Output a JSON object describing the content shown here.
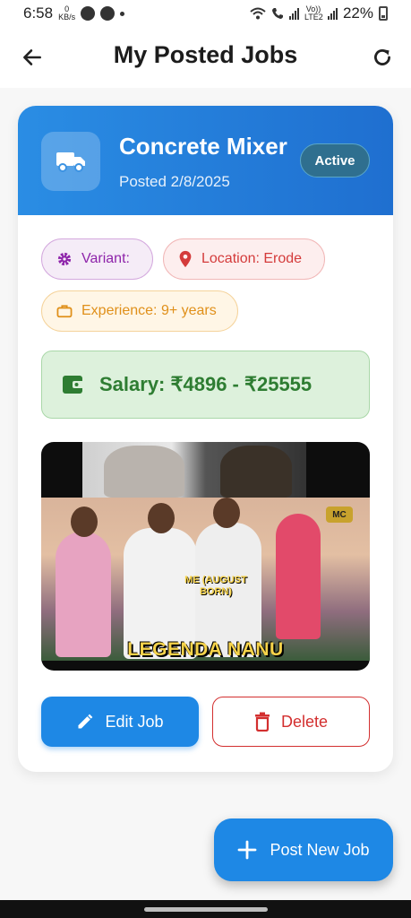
{
  "status_bar": {
    "time": "6:58",
    "net_speed_value": "0",
    "net_speed_unit": "KB/s",
    "battery": "22%",
    "volte_label": "Vo)) LTE2"
  },
  "app_bar": {
    "title": "My Posted Jobs",
    "back_icon": "arrow-back-icon",
    "refresh_icon": "refresh-icon"
  },
  "job": {
    "title": "Concrete Mixer",
    "posted": "Posted 2/8/2025",
    "status": "Active",
    "icon": "truck-icon",
    "chips": {
      "variant": "Variant:",
      "location": "Location: Erode",
      "experience": "Experience: 9+ years"
    },
    "salary": "Salary: ₹4896 - ₹25555",
    "image": {
      "caption_top": "ME (AUGUST BORN)",
      "caption_bottom": "LEGENDA NANU",
      "logo_text": "MC"
    },
    "actions": {
      "edit_label": "Edit Job",
      "delete_label": "Delete"
    }
  },
  "fab": {
    "label": "Post New Job"
  },
  "colors": {
    "primary": "#1e88e5",
    "header_gradient_end": "#1f6fd0",
    "variant": "#8e24aa",
    "location": "#d43b3b",
    "experience": "#e0901a",
    "salary": "#2e7d32",
    "delete": "#d32f2f"
  }
}
